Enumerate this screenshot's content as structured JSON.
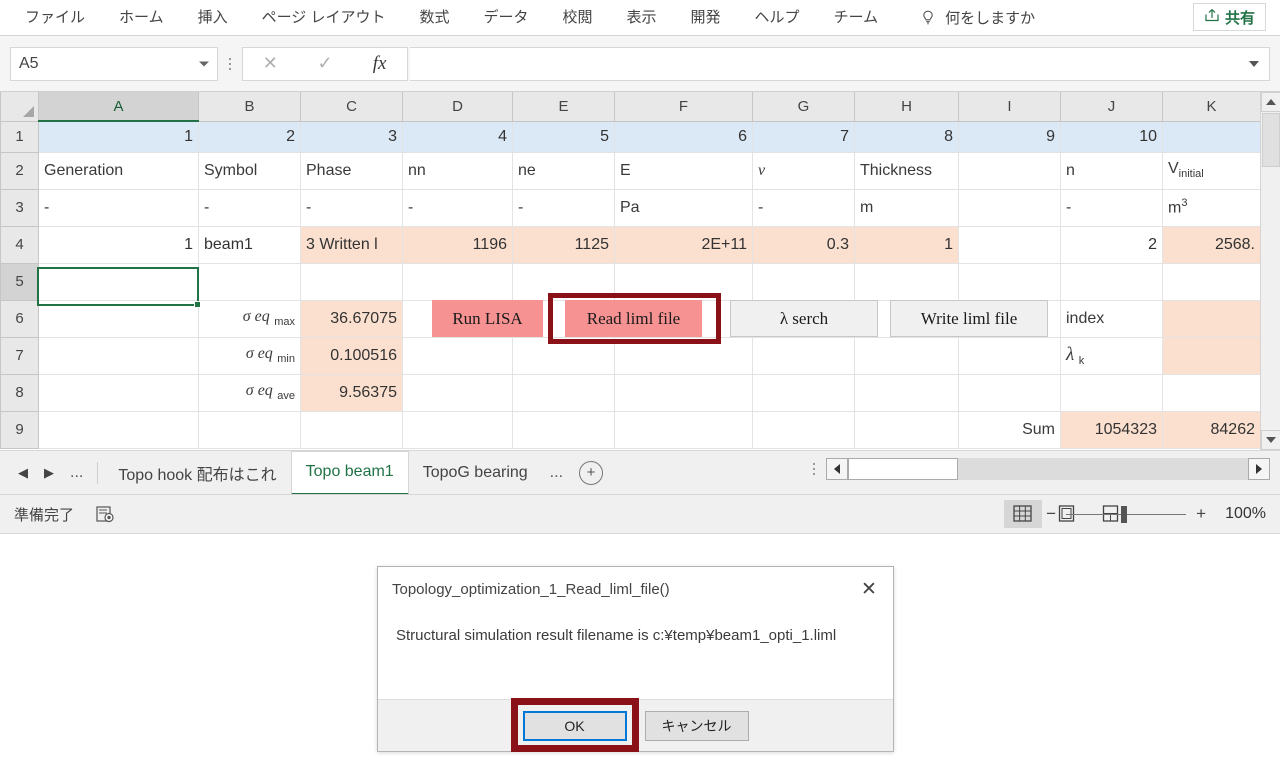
{
  "ribbon": {
    "tabs": [
      "ファイル",
      "ホーム",
      "挿入",
      "ページ レイアウト",
      "数式",
      "データ",
      "校閲",
      "表示",
      "開発",
      "ヘルプ",
      "チーム"
    ],
    "tell_me": "何をしますか",
    "share": "共有"
  },
  "formula_bar": {
    "name_box": "A5",
    "cancel": "✕",
    "enter": "✓",
    "fx": "fx",
    "formula_value": ""
  },
  "grid": {
    "columns": [
      "A",
      "B",
      "C",
      "D",
      "E",
      "F",
      "G",
      "H",
      "I",
      "J",
      "K"
    ],
    "selected_column": "A",
    "rows": [
      "1",
      "2",
      "3",
      "4",
      "5",
      "6",
      "7",
      "8",
      "9"
    ],
    "selected_row": "5",
    "selected_cell": "A5",
    "row1": [
      "1",
      "2",
      "3",
      "4",
      "5",
      "6",
      "7",
      "8",
      "9",
      "10",
      ""
    ],
    "row2": {
      "A": "Generation",
      "B": "Symbol",
      "C": "Phase",
      "D": "nn",
      "E": "ne",
      "F": "E",
      "G": "ν",
      "H": "Thickness",
      "I": "",
      "J": "n",
      "K_base": "V",
      "K_sub": "initial"
    },
    "row3": {
      "A": "-",
      "B": "-",
      "C": "-",
      "D": "-",
      "E": "-",
      "F": "Pa",
      "G": "-",
      "H": "m",
      "I": "",
      "J": "-",
      "K_base": "m",
      "K_sup": "3"
    },
    "row4": {
      "A": "1",
      "B": "beam1",
      "C": "3 Written l",
      "D": "1196",
      "E": "1125",
      "F": "2E+11",
      "G": "0.3",
      "H": "1",
      "I": "",
      "J": "2",
      "K": "2568."
    },
    "row6": {
      "B_base": "σ eq",
      "B_sub": "max",
      "C": "36.67075",
      "J": "index"
    },
    "row7": {
      "B_base": "σ eq",
      "B_sub": "min",
      "C": "0.100516",
      "J_base": "λ",
      "J_sub": "k"
    },
    "row8": {
      "B_base": "σ eq",
      "B_sub": "ave",
      "C": "9.56375"
    },
    "row9": {
      "I": "Sum",
      "J": "1054323",
      "K": "84262"
    }
  },
  "form_buttons": [
    {
      "label": "Run LISA",
      "style": "red",
      "highlighted": false
    },
    {
      "label": "Read liml file",
      "style": "red",
      "highlighted": true
    },
    {
      "label": "λ serch",
      "style": "gray",
      "highlighted": false
    },
    {
      "label": "Write liml file",
      "style": "gray",
      "highlighted": false
    }
  ],
  "sheet_tabs": {
    "prev": "◀",
    "next": "▶",
    "ellipsis": "...",
    "items": [
      {
        "label": "Topo hook 配布はこれ",
        "active": false
      },
      {
        "label": "Topo beam1",
        "active": true
      },
      {
        "label": "TopoG bearing",
        "active": false
      }
    ],
    "trailing_ellipsis": "...",
    "add": "+"
  },
  "status_bar": {
    "status": "準備完了",
    "zoom": "100%",
    "view_normal": "grid-view-icon",
    "view_layout": "page-layout-icon",
    "view_break": "page-break-icon",
    "zoom_out": "−",
    "zoom_in": "+"
  },
  "dialog": {
    "title": "Topology_optimization_1_Read_liml_file()",
    "close": "✕",
    "message": "Structural simulation result filename is c:¥temp¥beam1_opti_1.liml",
    "ok": "OK",
    "cancel": "キャンセル",
    "highlighted_button": "OK"
  },
  "colors": {
    "accent_green": "#217346",
    "highlight_red": "#8b1118",
    "button_red": "#f79292",
    "cell_peach": "#fbe0cf",
    "row1_blue": "#dbe8f5"
  }
}
